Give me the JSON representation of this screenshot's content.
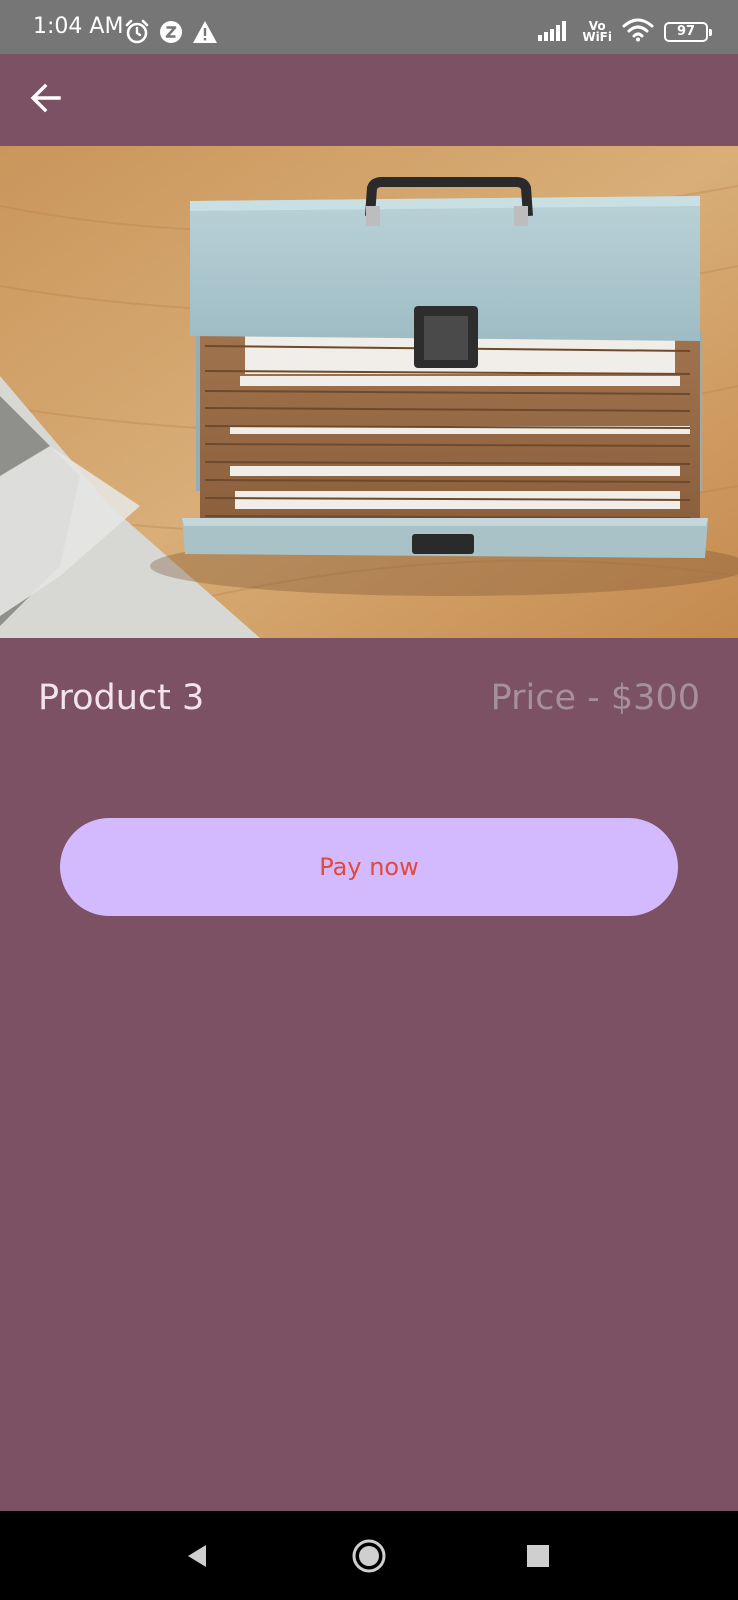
{
  "status_bar": {
    "time": "1:04 AM",
    "network_label_top": "Vo",
    "network_label_bottom": "WiFi",
    "battery_level": "97",
    "icons": [
      "alarm-icon",
      "z-app-icon",
      "warning-icon",
      "signal-icon",
      "wifi-icon",
      "battery-icon"
    ]
  },
  "app_bar": {
    "back_icon": "arrow-left-icon"
  },
  "product": {
    "image_subject": "accordion file box with handle",
    "name": "Product 3",
    "price": "Price - $300"
  },
  "actions": {
    "pay_label": "Pay now"
  },
  "nav_bar": {
    "icons": [
      "back-triangle-icon",
      "home-circle-icon",
      "recents-square-icon"
    ]
  },
  "colors": {
    "background": "#7b5163",
    "status_bar": "#767676",
    "button_bg": "#d3baff",
    "button_text": "#e04a3a",
    "name_text": "#f2e4ea",
    "price_text": "#a5909b"
  }
}
